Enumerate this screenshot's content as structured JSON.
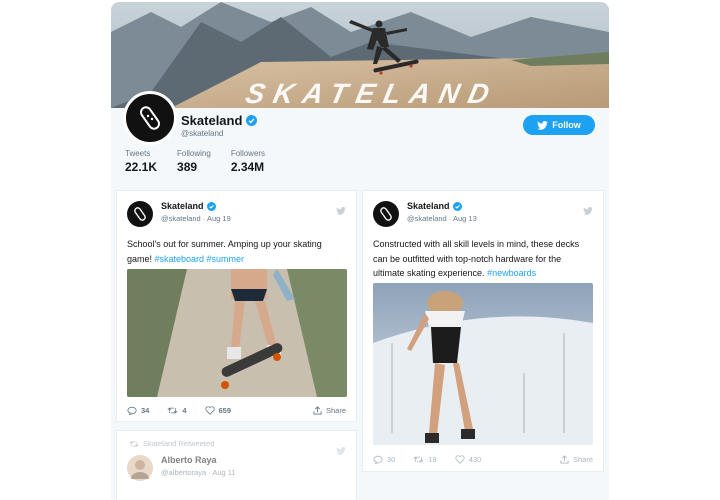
{
  "profile": {
    "name": "Skateland",
    "handle": "@skateland",
    "follow_label": "Follow",
    "banner_text": "SKATELAND",
    "stats": [
      {
        "label": "Tweets",
        "value": "22.1K"
      },
      {
        "label": "Following",
        "value": "389"
      },
      {
        "label": "Followers",
        "value": "2.34M"
      }
    ]
  },
  "tweets": [
    {
      "author": "Skateland",
      "meta": "@skateland · Aug 19",
      "text": "School's out for summer. Amping up your skating game! ",
      "hashtags": "#skateboard #summer",
      "replies": "34",
      "retweets": "4",
      "likes": "659",
      "share_label": "Share"
    },
    {
      "author": "Skateland",
      "meta": "@skateland · Aug 13",
      "text": "Constructed with all skill levels in mind, these decks can be outfitted with top-notch hardware for the ultimate skating experience. ",
      "hashtags": "#newboards",
      "replies": "30",
      "retweets": "19",
      "likes": "430",
      "share_label": "Share"
    },
    {
      "retweeted_by": "Skateland Retweeted",
      "author": "Alberto Raya",
      "meta": "@albertoraya · Aug 11"
    }
  ],
  "colors": {
    "accent": "#1da1f2",
    "muted": "#657786",
    "background": "#f5f8fa"
  }
}
